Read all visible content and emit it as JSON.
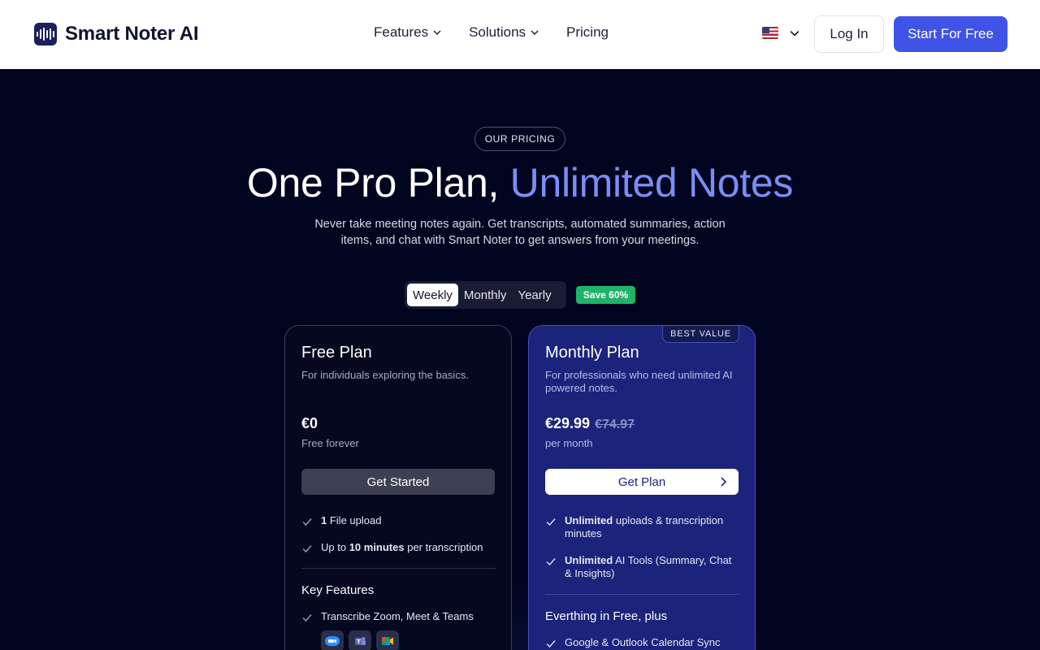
{
  "header": {
    "brand": "Smart Noter AI",
    "nav": [
      {
        "label": "Features",
        "has_dropdown": true
      },
      {
        "label": "Solutions",
        "has_dropdown": true
      },
      {
        "label": "Pricing",
        "has_dropdown": false
      }
    ],
    "language_icon": "us-flag-icon",
    "login_label": "Log In",
    "cta_label": "Start For Free"
  },
  "hero": {
    "badge": "OUR PRICING",
    "headline_main": "One Pro Plan, ",
    "headline_accent": "Unlimited Notes",
    "subline": "Never take meeting notes again. Get transcripts, automated summaries, action items, and chat with Smart Noter to get answers from your meetings."
  },
  "billing_toggle": {
    "options": [
      "Weekly",
      "Monthly",
      "Yearly"
    ],
    "selected": "Weekly",
    "save_badge": "Save 60%"
  },
  "plans": {
    "free": {
      "title": "Free Plan",
      "description": "For individuals exploring the basics.",
      "price": "€0",
      "price_note": "Free forever",
      "button": "Get Started",
      "features": [
        {
          "bold": "1",
          "text": " File upload",
          "prefix": ""
        },
        {
          "prefix": "Up to ",
          "bold": "10 minutes",
          "text": " per transcription"
        }
      ],
      "section_title": "Key Features",
      "key_features": [
        "Transcribe Zoom, Meet & Teams"
      ],
      "integration_icons": [
        "zoom-icon",
        "teams-icon",
        "google-meet-icon"
      ]
    },
    "pro": {
      "badge": "BEST VALUE",
      "title": "Monthly Plan",
      "description": "For professionals who need unlimited AI powered notes.",
      "price": "€29.99",
      "price_old": "€74.97",
      "price_note": "per month",
      "button": "Get Plan",
      "features": [
        {
          "prefix": "",
          "bold": "Unlimited",
          "text": " uploads & transcription minutes"
        },
        {
          "prefix": "",
          "bold": "Unlimited",
          "text": " AI Tools (Summary, Chat & Insights)"
        }
      ],
      "section_title": "Everthing in Free, plus",
      "key_features": [
        "Google & Outlook Calendar Sync"
      ]
    }
  },
  "colors": {
    "background": "#02051f",
    "accent": "#3f53e6",
    "headline_accent": "#7b8df5",
    "save_green": "#1fb36a",
    "pro_card": "#1b237a"
  }
}
